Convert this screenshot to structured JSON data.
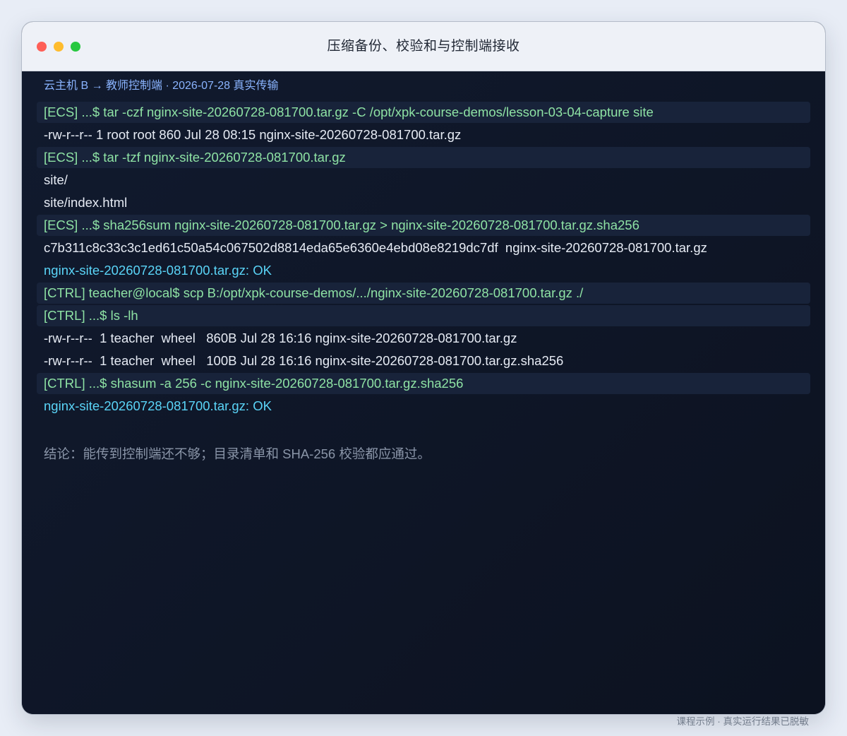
{
  "window": {
    "title": "压缩备份、校验和与控制端接收"
  },
  "terminal": {
    "banner": "云主机 B → 教师控制端 · 2026-07-28 真实传输",
    "lines": [
      {
        "kind": "cmd",
        "text": "[ECS] ...$ tar -czf nginx-site-20260728-081700.tar.gz -C /opt/xpk-course-demos/lesson-03-04-capture site"
      },
      {
        "kind": "out",
        "text": "-rw-r--r-- 1 root root 860 Jul 28 08:15 nginx-site-20260728-081700.tar.gz"
      },
      {
        "kind": "cmd",
        "text": "[ECS] ...$ tar -tzf nginx-site-20260728-081700.tar.gz"
      },
      {
        "kind": "out",
        "text": "site/"
      },
      {
        "kind": "out",
        "text": "site/index.html"
      },
      {
        "kind": "cmd",
        "text": "[ECS] ...$ sha256sum nginx-site-20260728-081700.tar.gz > nginx-site-20260728-081700.tar.gz.sha256"
      },
      {
        "kind": "out",
        "text": "c7b311c8c33c3c1ed61c50a54c067502d8814eda65e6360e4ebd08e8219dc7df  nginx-site-20260728-081700.tar.gz"
      },
      {
        "kind": "ok",
        "text": "nginx-site-20260728-081700.tar.gz: OK"
      },
      {
        "kind": "cmd",
        "text": "[CTRL] teacher@local$ scp B:/opt/xpk-course-demos/.../nginx-site-20260728-081700.tar.gz ./"
      },
      {
        "kind": "cmd",
        "text": "[CTRL] ...$ ls -lh"
      },
      {
        "kind": "out",
        "text": "-rw-r--r--  1 teacher  wheel   860B Jul 28 16:16 nginx-site-20260728-081700.tar.gz"
      },
      {
        "kind": "out",
        "text": "-rw-r--r--  1 teacher  wheel   100B Jul 28 16:16 nginx-site-20260728-081700.tar.gz.sha256"
      },
      {
        "kind": "cmd",
        "text": "[CTRL] ...$ shasum -a 256 -c nginx-site-20260728-081700.tar.gz.sha256"
      },
      {
        "kind": "ok",
        "text": "nginx-site-20260728-081700.tar.gz: OK"
      }
    ],
    "conclusion": "结论：能传到控制端还不够；目录清单和 SHA-256 校验都应通过。"
  },
  "caption": "课程示例 · 真实运行结果已脱敏",
  "colors": {
    "command": "#8ee2a4",
    "output": "#e6ebf4",
    "ok": "#5ad4f7",
    "banner": "#8ab4ff"
  }
}
